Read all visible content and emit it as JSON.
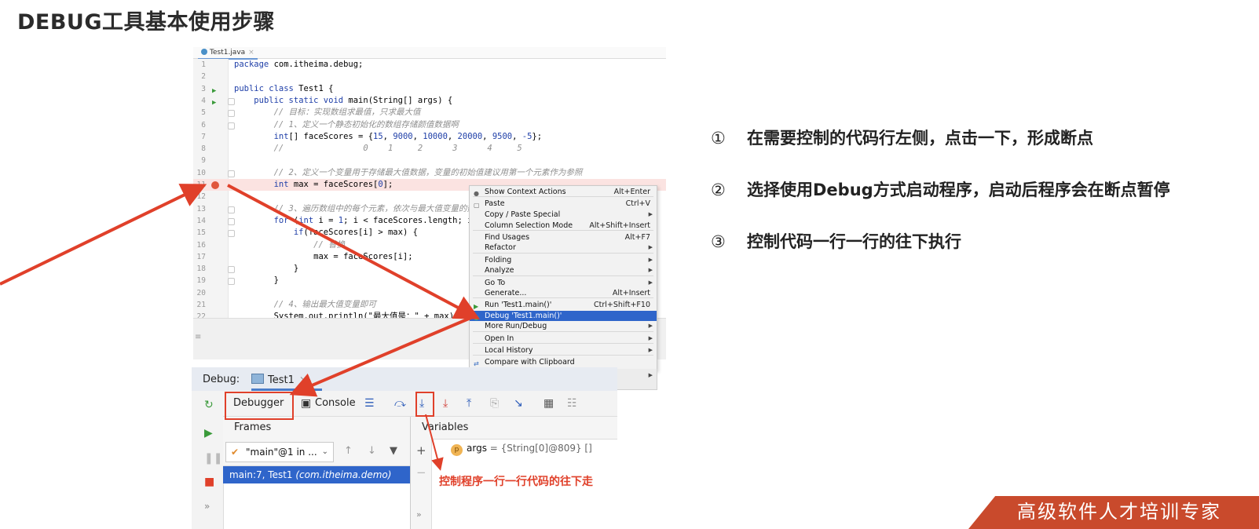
{
  "page": {
    "title": "DEBUG工具基本使用步骤",
    "steps": [
      {
        "num": "①",
        "text": "在需要控制的代码行左侧，点击一下，形成断点"
      },
      {
        "num": "②",
        "text": "选择使用Debug方式启动程序，启动后程序会在断点暂停"
      },
      {
        "num": "③",
        "text": "控制代码一行一行的往下执行"
      }
    ],
    "annotation": "控制程序一行一行代码的往下走",
    "footer_banner": "高级软件人才培训专家"
  },
  "editor": {
    "tab": "Test1.java",
    "lines": [
      {
        "n": "1",
        "html": "<span class=\"kw\">package</span> com.itheima.debug;"
      },
      {
        "n": "2",
        "html": ""
      },
      {
        "n": "3",
        "html": "<span class=\"kw\">public class</span> Test1 {"
      },
      {
        "n": "4",
        "html": "    <span class=\"kw\">public static void</span> main(String[] args) {"
      },
      {
        "n": "5",
        "html": "        <span class=\"cm\">// 目标：实现数组求最值，只求最大值</span>"
      },
      {
        "n": "6",
        "html": "        <span class=\"cm\">// 1、定义一个静态初始化的数组存储颜值数据啊</span>"
      },
      {
        "n": "7",
        "html": "        <span class=\"kw\">int</span>[] faceScores = {<span class=\"nm\">15</span>, <span class=\"nm\">9000</span>, <span class=\"nm\">10000</span>, <span class=\"nm\">20000</span>, <span class=\"nm\">9500</span>, <span class=\"nm\">-5</span>};"
      },
      {
        "n": "8",
        "html": "        <span class=\"cm\">//                0    1     2      3      4     5</span>"
      },
      {
        "n": "9",
        "html": ""
      },
      {
        "n": "10",
        "html": "        <span class=\"cm\">// 2、定义一个变量用于存储最大值数据，变量的初始值建议用第一个元素作为参照</span>"
      },
      {
        "n": "11",
        "html": "        <span class=\"kw\">int</span> max = faceScores[<span class=\"nm\">0</span>];"
      },
      {
        "n": "12",
        "html": ""
      },
      {
        "n": "13",
        "html": "        <span class=\"cm\">// 3、遍历数组中的每个元素，依次与最大值变量的数据进行比较</span>"
      },
      {
        "n": "14",
        "html": "        <span class=\"kw\">for</span> (<span class=\"kw\">int</span> i = <span class=\"nm\">1</span>; i &lt; faceScores.length; i++) {"
      },
      {
        "n": "15",
        "html": "            <span class=\"kw\">if</span>(faceScores[i] &gt; max) {"
      },
      {
        "n": "16",
        "html": "                <span class=\"cm\">// 替换</span>"
      },
      {
        "n": "17",
        "html": "                max = faceScores[i];"
      },
      {
        "n": "18",
        "html": "            }"
      },
      {
        "n": "19",
        "html": "        }"
      },
      {
        "n": "20",
        "html": ""
      },
      {
        "n": "21",
        "html": "        <span class=\"cm\">// 4、输出最大值变量即可</span>"
      },
      {
        "n": "22",
        "html": "        System.out.println(\"最大值是：\" + max);"
      }
    ]
  },
  "context_menu": {
    "items": [
      {
        "label": "Show Context Actions",
        "shortcut": "Alt+Enter",
        "icon": "bulb-icon"
      },
      {
        "label": "Paste",
        "shortcut": "Ctrl+V",
        "icon": "clipboard-icon"
      },
      {
        "label": "Copy / Paste Special",
        "shortcut": "",
        "submenu": true
      },
      {
        "label": "Column Selection Mode",
        "shortcut": "Alt+Shift+Insert"
      },
      {
        "label": "Find Usages",
        "shortcut": "Alt+F7"
      },
      {
        "label": "Refactor",
        "shortcut": "",
        "submenu": true
      },
      {
        "label": "Folding",
        "shortcut": "",
        "submenu": true
      },
      {
        "label": "Analyze",
        "shortcut": "",
        "submenu": true
      },
      {
        "label": "Go To",
        "shortcut": "",
        "submenu": true
      },
      {
        "label": "Generate...",
        "shortcut": "Alt+Insert"
      },
      {
        "label": "Run 'Test1.main()'",
        "shortcut": "Ctrl+Shift+F10",
        "icon": "run-icon"
      },
      {
        "label": "Debug 'Test1.main()'",
        "shortcut": "",
        "icon": "debug-icon",
        "highlighted": true
      },
      {
        "label": "More Run/Debug",
        "shortcut": "",
        "submenu": true
      },
      {
        "label": "Open In",
        "shortcut": "",
        "submenu": true
      },
      {
        "label": "Local History",
        "shortcut": "",
        "submenu": true
      },
      {
        "label": "Compare with Clipboard",
        "shortcut": "",
        "icon": "compare-icon"
      }
    ]
  },
  "debug": {
    "label": "Debug:",
    "tab": "Test1",
    "debugger_tab": "Debugger",
    "console_tab": "Console",
    "frames_header": "Frames",
    "variables_header": "Variables",
    "thread": "\"main\"@1 in ...",
    "frame_main": "main:7, Test1 ",
    "frame_pkg": "(com.itheima.demo)",
    "var_name": "args",
    "var_value": " = {String[0]@809} []"
  },
  "colors": {
    "highlight": "#2f65ca",
    "annotation": "#e0402a",
    "banner": "#c94a2c"
  }
}
